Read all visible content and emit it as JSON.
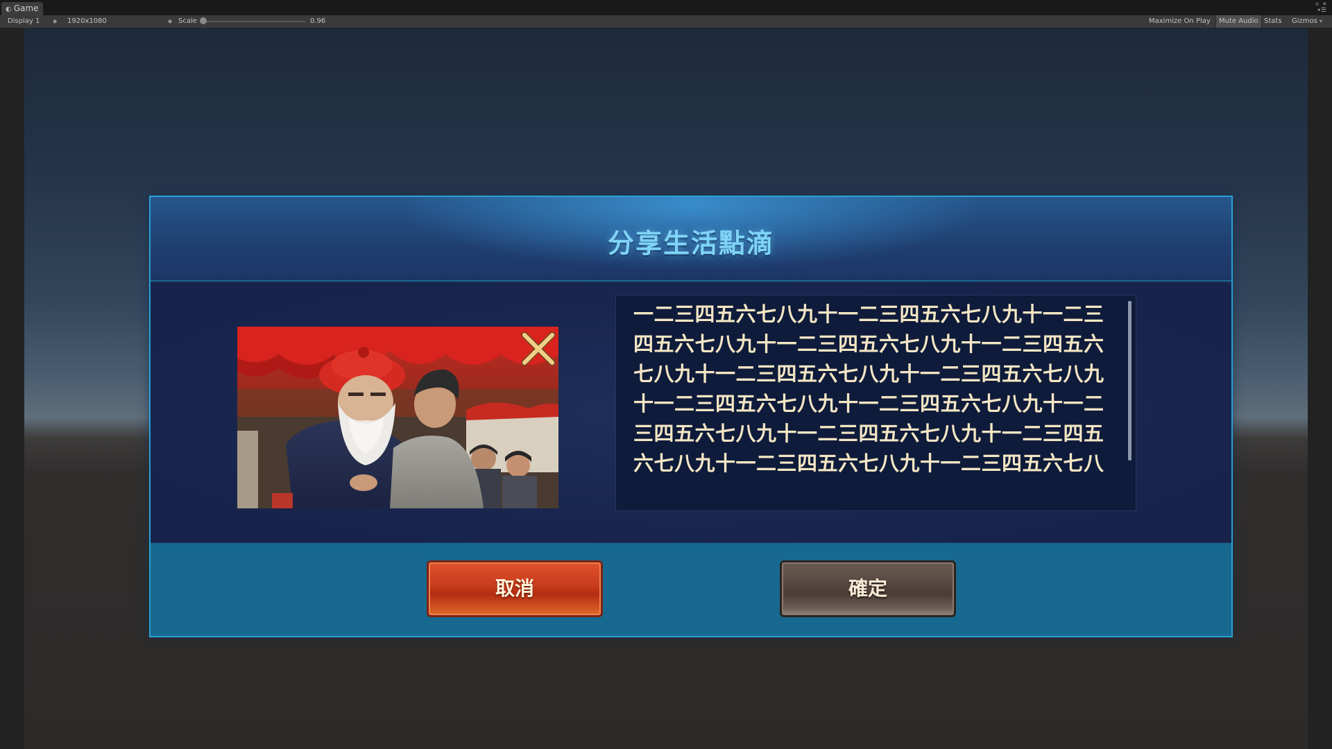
{
  "editor": {
    "tab_label": "Game",
    "display": "Display 1",
    "resolution": "1920x1080",
    "scale_label": "Scale",
    "scale_value": "0.96",
    "maximize_on_play": "Maximize On Play",
    "mute_audio": "Mute Audio",
    "stats": "Stats",
    "gizmos": "Gizmos"
  },
  "dialog": {
    "title": "分享生活點滴",
    "body_text": "一二三四五六七八九十一二三四五六七八九十一二三四五六七八九十一二三四五六七八九十一二三四五六七八九十一二三四五六七八九十一二三四五六七八九十一二三四五六七八九十一二三四五六七八九十一二三四五六七八九十一二三四五六七八九十一二三四五六七八九十一二三四五六七八九十一二三四五六七八",
    "cancel_label": "取消",
    "confirm_label": "確定"
  },
  "colors": {
    "title": "#7fd4f7",
    "body_text": "#f3e6c4",
    "cancel_button": "#c73b1c",
    "confirm_button": "#54463f",
    "dialog_border": "#2aa0d6"
  }
}
